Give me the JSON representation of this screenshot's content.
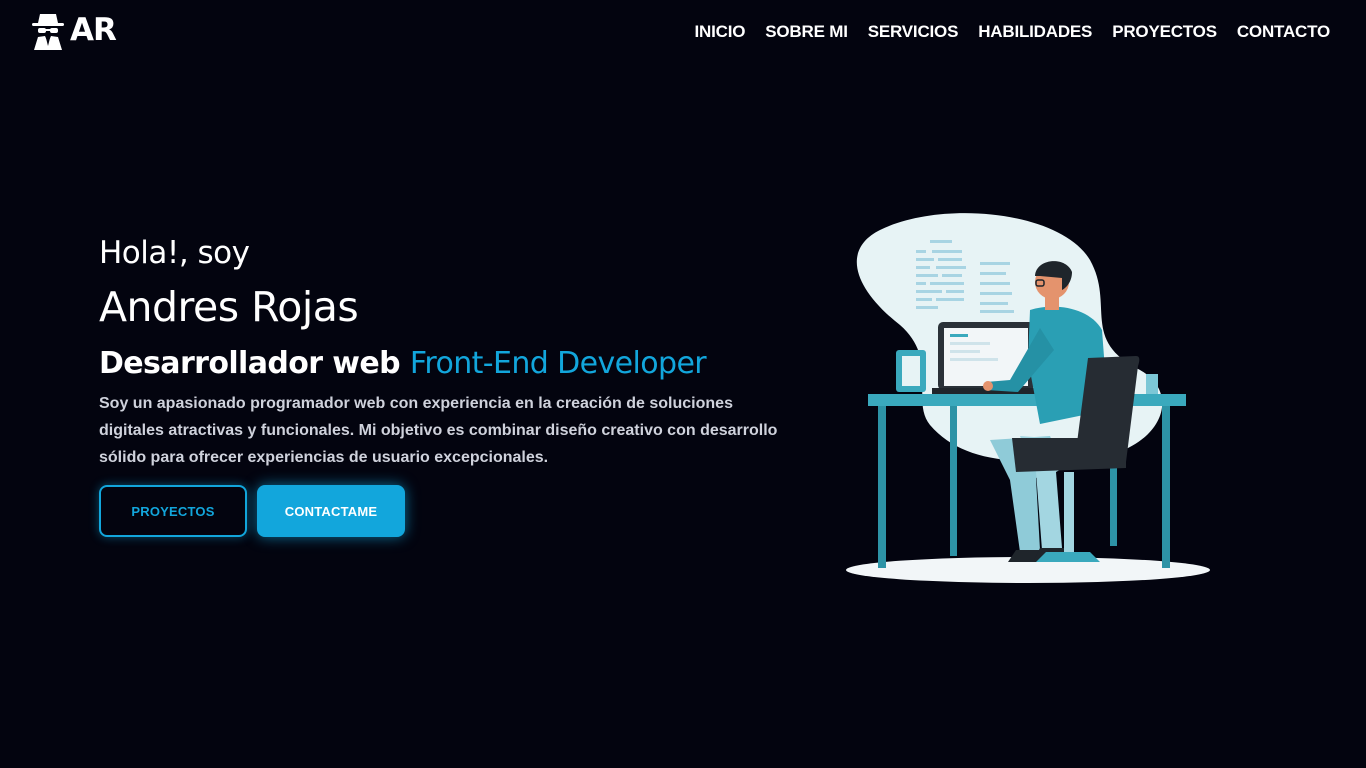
{
  "brand": {
    "logo_text": "AR",
    "logo_icon": "spy-icon"
  },
  "nav": {
    "items": [
      "INICIO",
      "SOBRE MI",
      "SERVICIOS",
      "HABILIDADES",
      "PROYECTOS",
      "CONTACTO"
    ]
  },
  "hero": {
    "greeting": "Hola!, soy",
    "name": "Andres Rojas",
    "role_prefix": "Desarrollador web",
    "role_accent": "Front-End Developer",
    "bio": "Soy un apasionado programador web con experiencia en la creación de soluciones digitales atractivas y funcionales. Mi objetivo es combinar diseño creativo con desarrollo sólido para ofrecer experiencias de usuario excepcionales.",
    "primary_button": "PROYECTOS",
    "secondary_button": "CONTACTAME"
  },
  "illustration": {
    "subject": "developer-at-desk-illustration"
  },
  "colors": {
    "background": "#03040f",
    "accent": "#12a6dc",
    "text": "#ffffff",
    "body_text": "#cfd2dc"
  }
}
